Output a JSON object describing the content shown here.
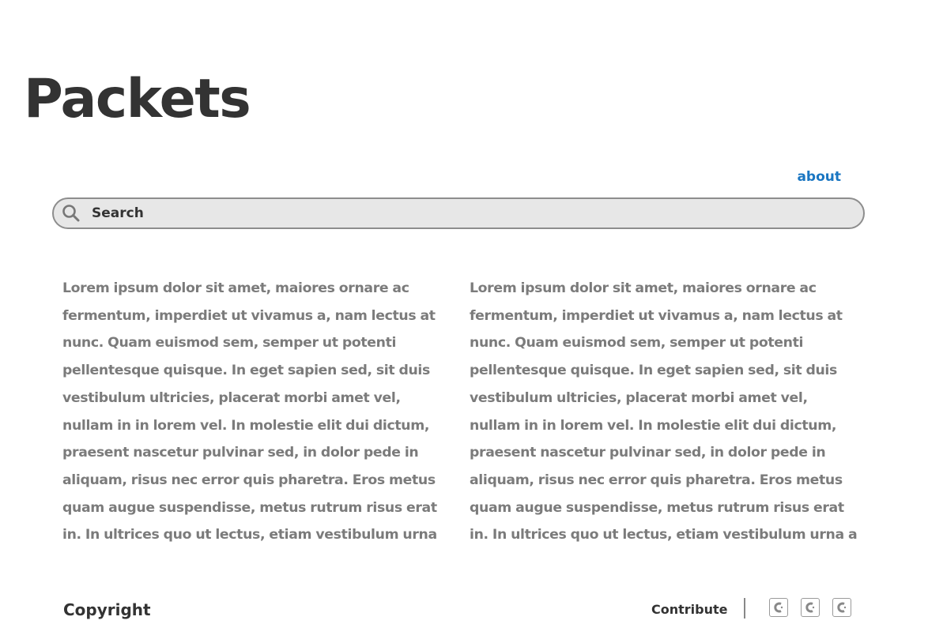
{
  "header": {
    "title": "Packets",
    "about_label": "about"
  },
  "search": {
    "placeholder": "Search",
    "value": ""
  },
  "content": {
    "columns": [
      "Lorem ipsum dolor sit amet, maiores ornare ac fermentum, imperdiet ut vivamus a, nam lectus at nunc. Quam euismod sem, semper ut potenti pellentesque quisque. In eget sapien sed, sit duis vestibulum ultricies, placerat morbi amet vel, nullam in in lorem vel. In molestie elit dui dictum, praesent nascetur pulvinar sed, in dolor pede in aliquam, risus nec error quis pharetra. Eros metus quam augue suspendisse, metus rutrum risus erat in.  In ultrices quo ut lectus, etiam vestibulum urna",
      "Lorem ipsum dolor sit amet, maiores ornare ac fermentum, imperdiet ut vivamus a, nam lectus at nunc. Quam euismod sem, semper ut potenti pellentesque quisque. In eget sapien sed, sit duis vestibulum ultricies, placerat morbi amet vel, nullam in in lorem vel. In molestie elit dui dictum, praesent nascetur pulvinar sed, in dolor pede in aliquam, risus nec error quis pharetra. Eros metus quam augue suspendisse, metus rutrum risus erat in.  In ultrices quo ut lectus, etiam vestibulum urna a"
    ]
  },
  "footer": {
    "copyright": "Copyright",
    "contribute_label": "Contribute",
    "social_icons": [
      "social-icon",
      "social-icon",
      "social-icon"
    ]
  },
  "colors": {
    "link": "#1a76c2",
    "body_text": "#7b7b7b",
    "heading": "#333333",
    "search_bg": "#e7e7e7"
  }
}
